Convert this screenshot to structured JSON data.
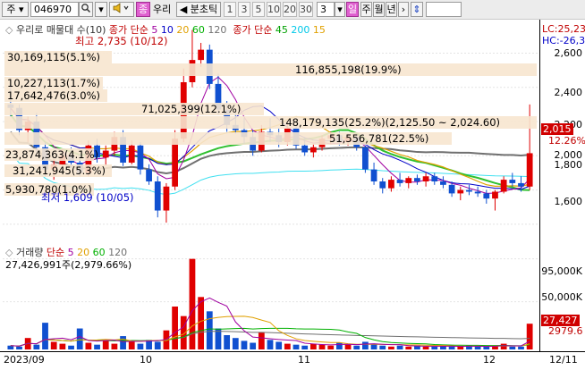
{
  "toolbar": {
    "market": "주",
    "code": "046970",
    "search_icon": "search-icon",
    "speaker_icon": "speaker-icon",
    "buy_tag": "종",
    "name": "우리",
    "tick_label": "◀ 분초틱",
    "periods": [
      "1",
      "3",
      "5",
      "10",
      "20",
      "30"
    ],
    "period_value": "3",
    "day_tag": "일",
    "tabs": [
      "주",
      "월",
      "년"
    ],
    "next_icon": "chevron-right-icon",
    "updown_icon": "updown-arrow-icon"
  },
  "legend": {
    "name": "우리로 매물대 수(10)",
    "ma_label": "종가 단순",
    "ma_values": [
      "5",
      "10",
      "20",
      "60",
      "120"
    ],
    "ma_colors": [
      "#a000a0",
      "#0000c8",
      "#e0a000",
      "#00b000",
      "#707070"
    ],
    "ma2_label": "종가 단순",
    "ma2_values": [
      "45",
      "200",
      "15"
    ],
    "ma2_colors": [
      "#00a000",
      "#00c8e8",
      "#e0a000"
    ]
  },
  "annotations": {
    "high": "최고 2,735 (10/12)",
    "low": "최저 1,609 (10/05)",
    "bands": [
      "30,169,115(5.1%)",
      "116,855,198(19.9%)",
      "10,227,113(1.7%)",
      "17,642,476(3.0%)",
      "71,025,399(12.1%)",
      "148,179,135(25.2%)(2,125.50 ~ 2,024.60)",
      "51,556,781(22.5%)",
      "23,874,363(4.1%)",
      "31,241,945(5.3%)",
      "5,930,780(1.0%)"
    ]
  },
  "volume": {
    "label": "거래량",
    "ma_label": "단순",
    "ma_values": [
      "5",
      "20",
      "60",
      "120"
    ],
    "total": "27,426,991주(2,979.66%)"
  },
  "right_axis": {
    "lc": "LC:25,23",
    "hc": "HC:-26,3",
    "ticks": [
      "2,600",
      "2,400",
      "2,200",
      "2,000",
      "1,800",
      "1,600"
    ],
    "current_price": "2,015",
    "change_pct": "12.26%",
    "vol_ticks": [
      "95,000K",
      "50,000K"
    ],
    "vol_current": "27,427",
    "vol_avg": "2979.6"
  },
  "xaxis": {
    "labels": [
      "2023/09",
      "10",
      "11",
      "12",
      "12/11"
    ]
  },
  "chart_data": {
    "type": "candlestick",
    "ylim": [
      1500,
      2780
    ],
    "candles": [
      [
        2300,
        2420,
        2230,
        2280
      ],
      [
        2280,
        2300,
        2120,
        2150
      ],
      [
        2150,
        2230,
        2080,
        2200
      ],
      [
        2200,
        2250,
        2020,
        2050
      ],
      [
        2050,
        2080,
        1880,
        1920
      ],
      [
        1920,
        1980,
        1860,
        1950
      ],
      [
        1950,
        2040,
        1920,
        2000
      ],
      [
        2000,
        2050,
        1930,
        1960
      ],
      [
        1960,
        2010,
        1880,
        1900
      ],
      [
        1900,
        2090,
        1880,
        2060
      ],
      [
        2060,
        2100,
        1960,
        1990
      ],
      [
        1990,
        2060,
        1940,
        2030
      ],
      [
        2030,
        2140,
        2000,
        2110
      ],
      [
        2110,
        2150,
        1940,
        1960
      ],
      [
        1960,
        2090,
        1950,
        2060
      ],
      [
        2060,
        2080,
        1890,
        1920
      ],
      [
        1920,
        1950,
        1830,
        1850
      ],
      [
        1850,
        1880,
        1640,
        1680
      ],
      [
        1680,
        1840,
        1609,
        1820
      ],
      [
        1820,
        2150,
        1800,
        2100
      ],
      [
        2100,
        2510,
        2080,
        2430
      ],
      [
        2430,
        2735,
        2400,
        2560
      ],
      [
        2560,
        2660,
        2520,
        2620
      ],
      [
        2620,
        2650,
        2390,
        2420
      ],
      [
        2420,
        2480,
        2240,
        2270
      ],
      [
        2270,
        2320,
        2140,
        2180
      ],
      [
        2180,
        2250,
        2130,
        2150
      ],
      [
        2150,
        2220,
        2070,
        2110
      ],
      [
        2110,
        2150,
        2000,
        2030
      ],
      [
        2030,
        2180,
        2020,
        2140
      ],
      [
        2140,
        2220,
        2080,
        2120
      ],
      [
        2120,
        2160,
        2050,
        2080
      ],
      [
        2080,
        2200,
        2060,
        2160
      ],
      [
        2160,
        2180,
        2040,
        2060
      ],
      [
        2060,
        2110,
        2000,
        2020
      ],
      [
        2020,
        2070,
        1990,
        2050
      ],
      [
        2050,
        2120,
        2030,
        2100
      ],
      [
        2100,
        2140,
        2070,
        2120
      ],
      [
        2120,
        2140,
        2060,
        2080
      ],
      [
        2080,
        2130,
        2060,
        2110
      ],
      [
        2110,
        2120,
        2030,
        2050
      ],
      [
        2050,
        2060,
        1900,
        1920
      ],
      [
        1920,
        1960,
        1830,
        1850
      ],
      [
        1850,
        1870,
        1780,
        1810
      ],
      [
        1810,
        1880,
        1790,
        1860
      ],
      [
        1860,
        1900,
        1820,
        1840
      ],
      [
        1840,
        1880,
        1810,
        1870
      ],
      [
        1870,
        1890,
        1830,
        1850
      ],
      [
        1850,
        1900,
        1820,
        1880
      ],
      [
        1880,
        1900,
        1830,
        1850
      ],
      [
        1850,
        1880,
        1810,
        1830
      ],
      [
        1830,
        1850,
        1760,
        1780
      ],
      [
        1780,
        1820,
        1740,
        1800
      ],
      [
        1800,
        1830,
        1770,
        1790
      ],
      [
        1790,
        1820,
        1760,
        1780
      ],
      [
        1780,
        1800,
        1720,
        1750
      ],
      [
        1750,
        1800,
        1680,
        1790
      ],
      [
        1790,
        1880,
        1780,
        1860
      ],
      [
        1860,
        1900,
        1820,
        1840
      ],
      [
        1840,
        1880,
        1790,
        1820
      ],
      [
        1820,
        2300,
        1800,
        2015
      ]
    ],
    "volume": [
      4,
      3,
      12,
      5,
      28,
      8,
      6,
      4,
      22,
      7,
      5,
      9,
      6,
      14,
      8,
      6,
      10,
      8,
      20,
      45,
      35,
      95,
      55,
      40,
      22,
      15,
      12,
      9,
      7,
      18,
      10,
      8,
      6,
      5,
      4,
      6,
      5,
      4,
      7,
      5,
      4,
      8,
      6,
      4,
      3,
      4,
      3,
      4,
      3,
      3,
      4,
      3,
      3,
      4,
      3,
      3,
      4,
      6,
      3,
      3,
      27
    ],
    "volume_ylim": [
      0,
      105
    ]
  }
}
